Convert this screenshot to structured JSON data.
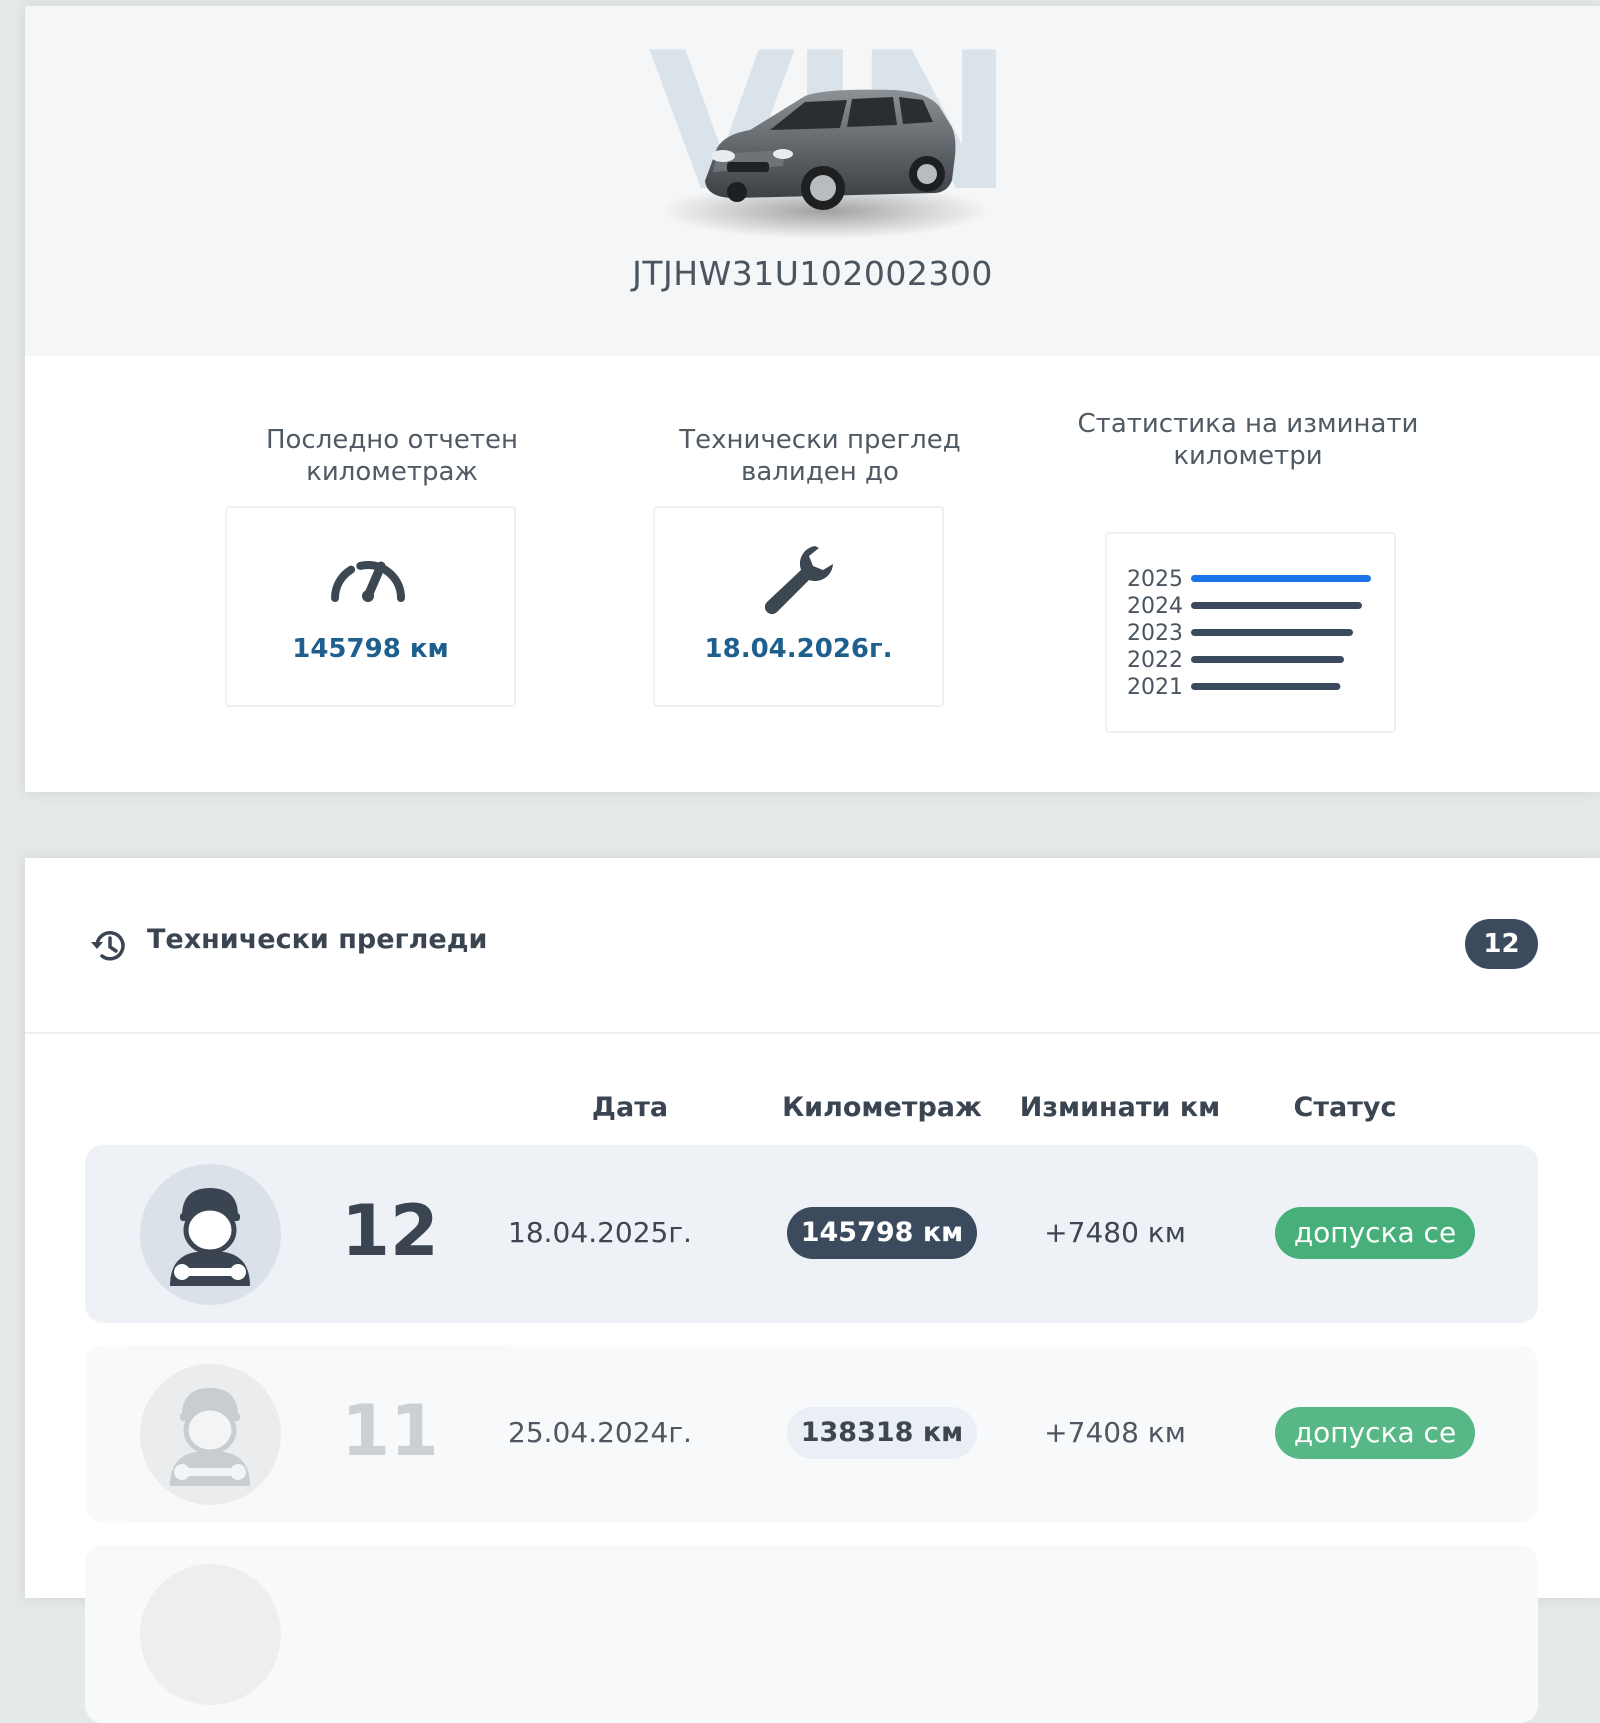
{
  "vehicle": {
    "watermark": "VIN",
    "vin": "JTJHW31U102002300"
  },
  "stats": {
    "mileage": {
      "label": "Последно отчетен километраж",
      "value": "145798 км",
      "icon": "speedometer-icon"
    },
    "inspection": {
      "label": "Технически преглед валиден до",
      "value": "18.04.2026г.",
      "icon": "wrench-icon"
    },
    "distance": {
      "label": "Статистика на изминати километри"
    }
  },
  "chart_data": {
    "type": "bar",
    "orientation": "horizontal",
    "categories": [
      "2025",
      "2024",
      "2023",
      "2022",
      "2021"
    ],
    "values": [
      100,
      95,
      90,
      85,
      83
    ],
    "colors": [
      "#1a73e8",
      "#3b4a5c",
      "#3b4a5c",
      "#3b4a5c",
      "#3b4a5c"
    ],
    "title": "",
    "xlabel": "",
    "ylabel": ""
  },
  "history": {
    "title": "Технически прегледи",
    "icon": "history-icon",
    "count": "12",
    "columns": {
      "date": "Дата",
      "mileage": "Километраж",
      "distance": "Изминати км",
      "status": "Статус"
    },
    "rows": [
      {
        "number": "12",
        "date": "18.04.2025г.",
        "mileage": "145798 км",
        "distance": "+7480 км",
        "status": "допуска се"
      },
      {
        "number": "11",
        "date": "25.04.2024г.",
        "mileage": "138318 км",
        "distance": "+7408 км",
        "status": "допуска се"
      }
    ]
  },
  "colors": {
    "accent_blue": "#1f5f8e",
    "chart_highlight": "#1a73e8",
    "dark_slate": "#3b4a5c",
    "status_green": "#47b07a"
  }
}
